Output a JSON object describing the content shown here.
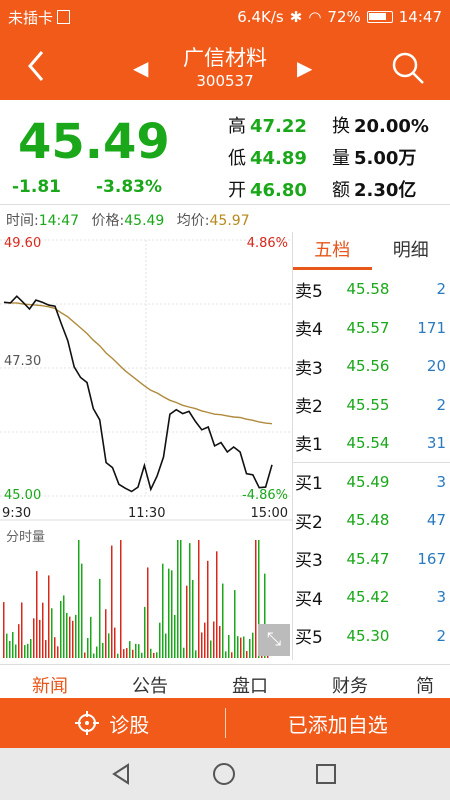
{
  "statusbar": {
    "carrier": "未插卡",
    "speed": "6.4K/s",
    "battery": "72%",
    "time": "14:47"
  },
  "header": {
    "name": "广信材料",
    "code": "300537"
  },
  "quote": {
    "price": "45.49",
    "change": "-1.81",
    "change_pct": "-3.83%",
    "high_label": "高",
    "high": "47.22",
    "low_label": "低",
    "low": "44.89",
    "open_label": "开",
    "open": "46.80",
    "turnover_label": "换",
    "turnover": "20.00%",
    "volume_label": "量",
    "volume": "5.00万",
    "amount_label": "额",
    "amount": "2.30亿"
  },
  "info": {
    "time_label": "时间:",
    "time": "14:47",
    "price_label": "价格:",
    "price": "45.49",
    "avg_label": "均价:",
    "avg": "45.97"
  },
  "chart": {
    "top_price": "49.60",
    "top_pct": "4.86%",
    "mid_price": "47.30",
    "bottom_price": "45.00",
    "bottom_pct": "-4.86%",
    "t_start": "9:30",
    "t_mid": "11:30",
    "t_end": "15:00",
    "volume_label": "分时量",
    "colors": {
      "price": "#111111",
      "avg": "#b08a3c",
      "up": "#d8281c",
      "down": "#1aa81a"
    }
  },
  "chart_data": {
    "type": "line",
    "ylim": [
      45.0,
      49.6
    ],
    "series": [
      {
        "name": "价格",
        "values": [
          48.48,
          48.47,
          48.59,
          48.48,
          48.36,
          48.52,
          48.48,
          48.43,
          48.41,
          48.09,
          47.79,
          47.32,
          47.13,
          47.04,
          46.57,
          46.37,
          45.6,
          45.51,
          45.21,
          45.14,
          45.08,
          45.16,
          45.55,
          45.12,
          45.36,
          45.7,
          46.47,
          46.55,
          46.48,
          46.52,
          46.34,
          46.19,
          46.24,
          45.9,
          45.96,
          45.79,
          45.88,
          45.79,
          45.4,
          45.38,
          45.15,
          45.16,
          45.56
        ]
      },
      {
        "name": "均价",
        "values": [
          48.48,
          48.47,
          48.47,
          48.45,
          48.44,
          48.43,
          48.42,
          48.4,
          48.37,
          48.29,
          48.22,
          48.12,
          48.02,
          47.92,
          47.8,
          47.7,
          47.57,
          47.47,
          47.36,
          47.25,
          47.16,
          47.07,
          46.98,
          46.9,
          46.85,
          46.78,
          46.72,
          46.68,
          46.63,
          46.6,
          46.57,
          46.53,
          46.5,
          46.47,
          46.46,
          46.44,
          46.42,
          46.41,
          46.38,
          46.36,
          46.33,
          46.31,
          46.3
        ]
      }
    ]
  },
  "orders": {
    "tab_active": "五档",
    "tab_other": "明细",
    "rows": [
      {
        "label": "卖5",
        "price": "45.58",
        "qty": "2"
      },
      {
        "label": "卖4",
        "price": "45.57",
        "qty": "171"
      },
      {
        "label": "卖3",
        "price": "45.56",
        "qty": "20"
      },
      {
        "label": "卖2",
        "price": "45.55",
        "qty": "2"
      },
      {
        "label": "卖1",
        "price": "45.54",
        "qty": "31"
      },
      {
        "label": "买1",
        "price": "45.49",
        "qty": "3"
      },
      {
        "label": "买2",
        "price": "45.48",
        "qty": "47"
      },
      {
        "label": "买3",
        "price": "45.47",
        "qty": "167"
      },
      {
        "label": "买4",
        "price": "45.42",
        "qty": "3"
      },
      {
        "label": "买5",
        "price": "45.30",
        "qty": "2"
      }
    ]
  },
  "bottom_tabs": [
    "新闻",
    "公告",
    "盘口",
    "财务",
    "简"
  ],
  "actions": {
    "diagnose": "诊股",
    "added": "已添加自选"
  },
  "icons": [
    "back-icon",
    "prev-arrow-icon",
    "next-arrow-icon",
    "search-icon",
    "crosshair-icon",
    "expand-icon",
    "nav-back-icon",
    "nav-home-icon",
    "nav-recent-icon"
  ]
}
